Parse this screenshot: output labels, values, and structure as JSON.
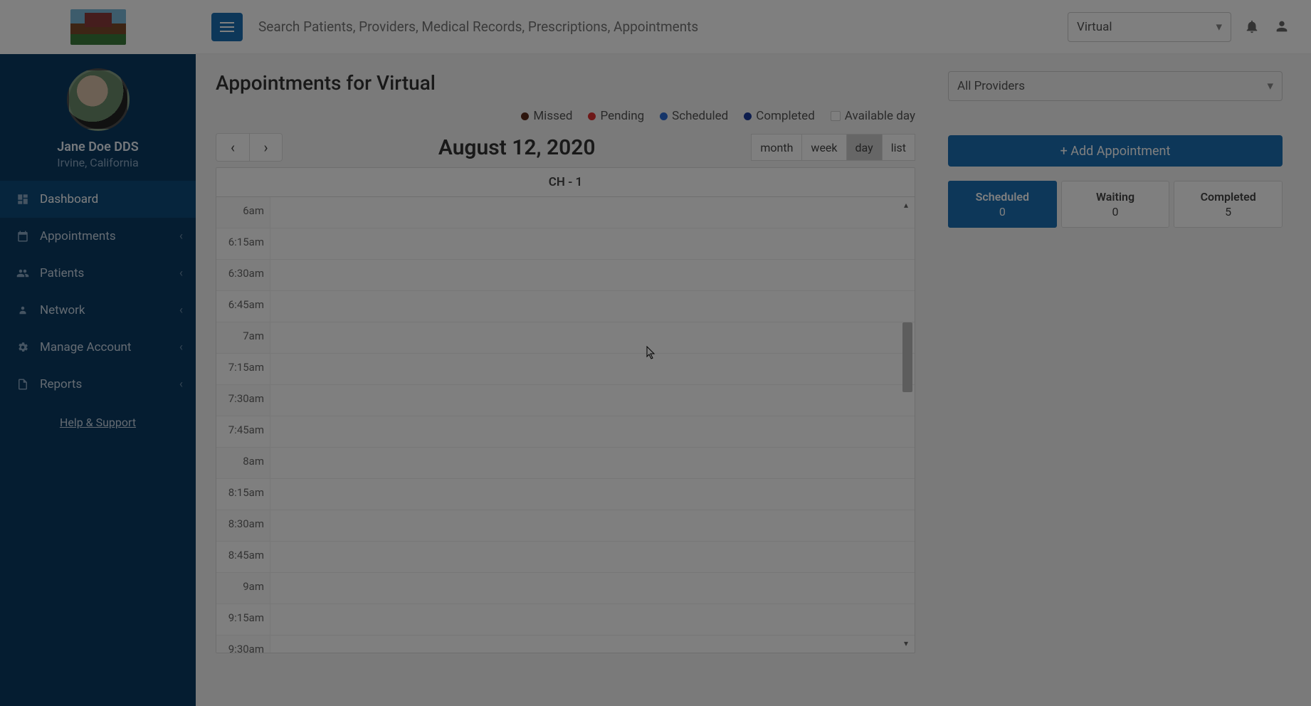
{
  "header": {
    "search_placeholder": "Search Patients, Providers, Medical Records, Prescriptions, Appointments",
    "location_selected": "Virtual"
  },
  "profile": {
    "name": "Jane Doe DDS",
    "location": "Irvine, California"
  },
  "nav": {
    "items": [
      {
        "label": "Dashboard",
        "expandable": false,
        "active": true
      },
      {
        "label": "Appointments",
        "expandable": true
      },
      {
        "label": "Patients",
        "expandable": true
      },
      {
        "label": "Network",
        "expandable": true
      },
      {
        "label": "Manage Account",
        "expandable": true
      },
      {
        "label": "Reports",
        "expandable": true
      }
    ],
    "help": "Help & Support"
  },
  "page": {
    "title": "Appointments for Virtual",
    "provider_selected": "All Providers"
  },
  "legend": {
    "missed": {
      "label": "Missed",
      "color": "#5a2a1a"
    },
    "pending": {
      "label": "Pending",
      "color": "#d33"
    },
    "scheduled": {
      "label": "Scheduled",
      "color": "#2a6ad3"
    },
    "completed": {
      "label": "Completed",
      "color": "#1a3a9a"
    },
    "available": {
      "label": "Available day",
      "color": "#f5f5f5"
    }
  },
  "calendar": {
    "date_title": "August 12, 2020",
    "views": [
      "month",
      "week",
      "day",
      "list"
    ],
    "active_view": "day",
    "column_header": "CH - 1",
    "time_slots": [
      "6am",
      "6:15am",
      "6:30am",
      "6:45am",
      "7am",
      "7:15am",
      "7:30am",
      "7:45am",
      "8am",
      "8:15am",
      "8:30am",
      "8:45am",
      "9am",
      "9:15am",
      "9:30am"
    ]
  },
  "actions": {
    "add_appointment": "+ Add Appointment"
  },
  "status_tabs": [
    {
      "label": "Scheduled",
      "count": "0",
      "active": true
    },
    {
      "label": "Waiting",
      "count": "0"
    },
    {
      "label": "Completed",
      "count": "5"
    }
  ]
}
